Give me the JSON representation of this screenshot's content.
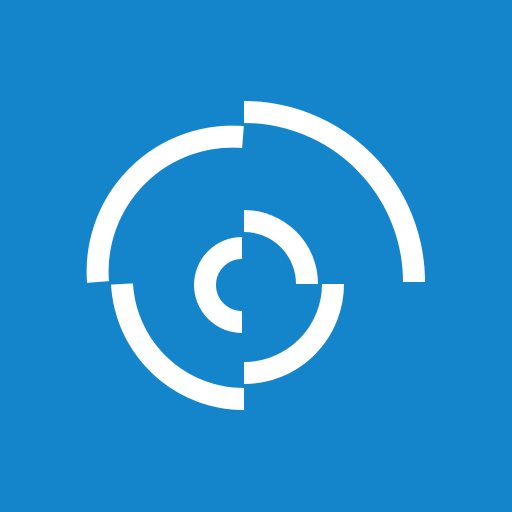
{
  "colors": {
    "background": "#1585cb",
    "mark": "#ffffff"
  },
  "icon": {
    "name": "segmented-concentric-arcs-logo-icon"
  }
}
